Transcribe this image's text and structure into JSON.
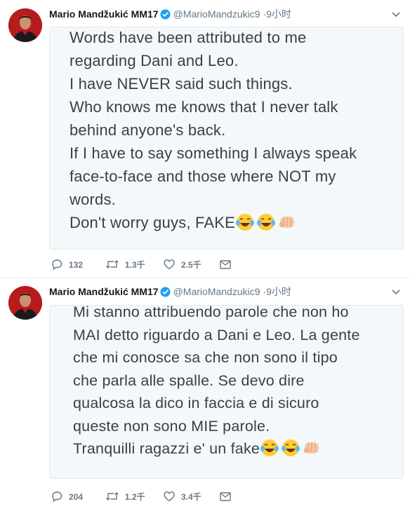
{
  "tweets": [
    {
      "author_name": "Mario Mandžukić MM17",
      "handle": "@MarioMandzukic9",
      "dot": "·",
      "time": "9小时",
      "lines": [
        "Words have been attributed to me",
        "regarding Dani and Leo.",
        "I have NEVER said such things.",
        "Who knows me knows that I never talk",
        "behind anyone's back.",
        "If I have to say something I always speak",
        "face-to-face and those where NOT my",
        "words.",
        "Don't worry guys, FAKE"
      ],
      "trailing_emoji": [
        "face-with-tears-of-joy-icon",
        "face-with-tears-of-joy-icon",
        "oncoming-fist-icon"
      ],
      "replies": "132",
      "retweets": "1.3千",
      "likes": "2.5千"
    },
    {
      "author_name": "Mario Mandžukić MM17",
      "handle": "@MarioMandzukic9",
      "dot": "·",
      "time": "9小时",
      "lines": [
        "Mi stanno attribuendo parole che non ho",
        "MAI detto riguardo a Dani e Leo. La gente",
        "che mi conosce sa che non sono il tipo",
        "che parla alle spalle. Se devo dire",
        "qualcosa la dico in faccia e di sicuro",
        "queste non sono MIE parole.",
        "Tranquilli ragazzi e' un fake"
      ],
      "trailing_emoji": [
        "face-with-tears-of-joy-icon",
        "face-with-tears-of-joy-icon",
        "oncoming-fist-icon"
      ],
      "replies": "204",
      "retweets": "1.2千",
      "likes": "3.4千"
    }
  ],
  "colors": {
    "text": "#14171a",
    "muted": "#657786",
    "verified": "#1da1f2",
    "card_bg": "#f5f8fa",
    "card_border": "#e1e8ed",
    "avatar_bg": "#b71c1c"
  }
}
